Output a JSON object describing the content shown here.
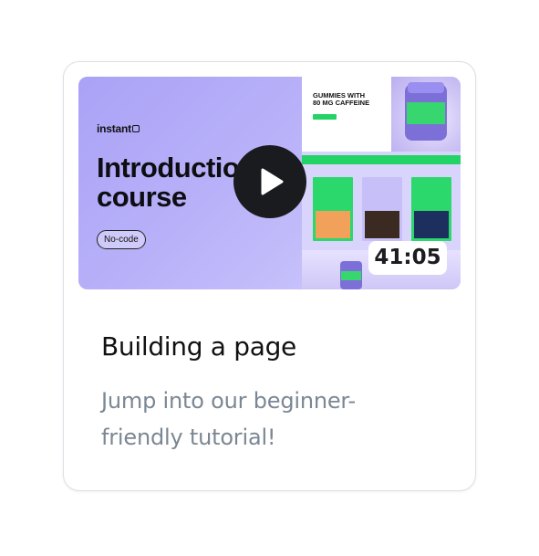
{
  "video": {
    "brand": "instant",
    "thumbnail_title_line1": "Introduction",
    "thumbnail_title_line2": "course",
    "badge": "No-code",
    "duration": "41:05",
    "mockup": {
      "headline_line1": "GUMMIES WITH",
      "headline_line2": "80 MG CAFFEINE"
    },
    "accent_color": "#22d366",
    "thumbnail_bg": "#aaa2f6"
  },
  "card": {
    "title": "Building a page",
    "description": "Jump into our beginner-friendly tutorial!"
  }
}
